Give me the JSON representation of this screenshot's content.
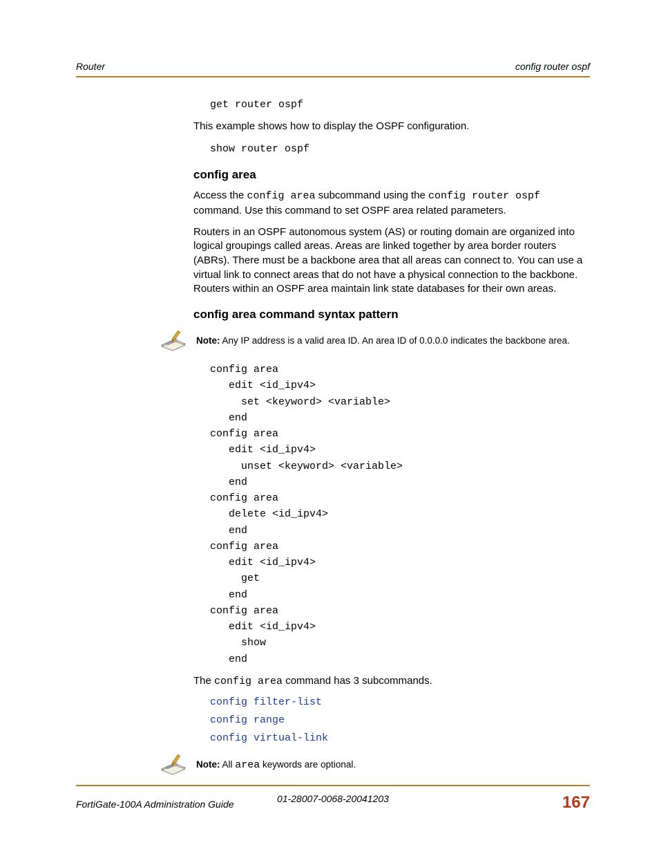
{
  "header": {
    "left": "Router",
    "right": "config router ospf"
  },
  "body": {
    "code1": "get router ospf",
    "p1_a": "This example shows how to display the OSPF configuration.",
    "code2": "show router ospf",
    "h1": "config area",
    "p2_a": "Access the ",
    "p2_code1": "config area",
    "p2_b": " subcommand using the ",
    "p2_code2": "config router ospf",
    "p2_c": " command. Use this command to set OSPF area related parameters.",
    "p3": "Routers in an OSPF autonomous system (AS) or routing domain are organized into logical groupings called areas. Areas are linked together by area border routers (ABRs). There must be a backbone area that all areas can connect to. You can use a virtual link to connect areas that do not have a physical connection to the backbone. Routers within an OSPF area maintain link state databases for their own areas.",
    "h2": "config area command syntax pattern",
    "note1_b": "Note:",
    "note1_t": " Any IP address is a valid area ID. An area ID of 0.0.0.0 indicates the backbone area.",
    "code3": "config area\n   edit <id_ipv4>\n     set <keyword> <variable>\n   end\nconfig area\n   edit <id_ipv4>\n     unset <keyword> <variable>\n   end\nconfig area\n   delete <id_ipv4>\n   end\nconfig area\n   edit <id_ipv4>\n     get\n   end\nconfig area\n   edit <id_ipv4>\n     show\n   end",
    "p4_a": "The ",
    "p4_code": "config area",
    "p4_b": " command has 3 subcommands.",
    "link1": "config filter-list",
    "link2": "config range",
    "link3": "config virtual-link",
    "note2_b": "Note:",
    "note2_a": " All ",
    "note2_code": "area",
    "note2_c": " keywords are optional."
  },
  "footer": {
    "left": "FortiGate-100A Administration Guide",
    "mid": "01-28007-0068-20041203",
    "page": "167"
  }
}
